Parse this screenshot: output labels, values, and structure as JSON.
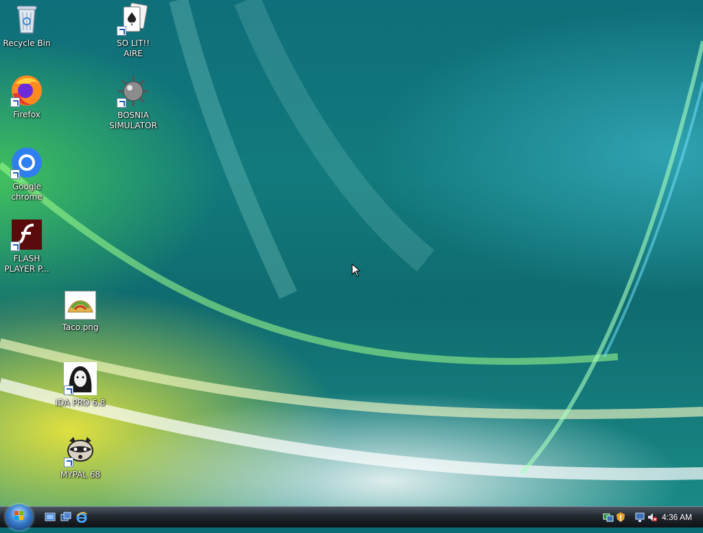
{
  "desktop": {
    "icons": [
      {
        "label": "Recycle Bin"
      },
      {
        "label": "SO LIT!! AIRE"
      },
      {
        "label": "Firefox"
      },
      {
        "label": "BOSNIA SIMULATOR"
      },
      {
        "label": "Google chrome"
      },
      {
        "label": "FLASH PLAYER P..."
      },
      {
        "label": "Taco.png"
      },
      {
        "label": "IDA PRO 6.8"
      },
      {
        "label": "MYPAL 68"
      }
    ]
  },
  "taskbar": {
    "clock": "4:36 AM",
    "quick_launch": [
      "show-desktop-icon",
      "switch-windows-icon",
      "internet-explorer-icon"
    ],
    "tray": [
      "network-icon",
      "security-alert-icon",
      "network-connection-icon",
      "volume-muted-icon"
    ]
  },
  "colors": {
    "taskbar": "#1b2026",
    "start_orb": "#3a7fd0",
    "wallpaper_teal": "#127a7c",
    "wallpaper_yellow": "#e6e23a"
  }
}
